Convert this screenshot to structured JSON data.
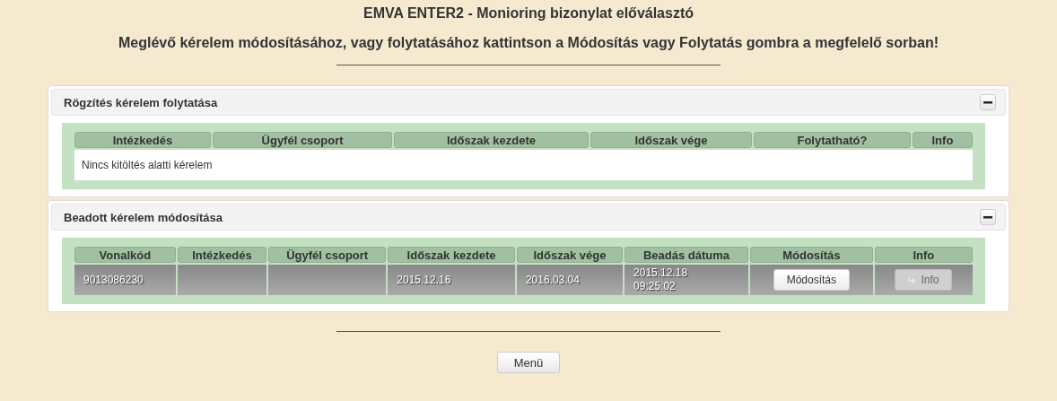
{
  "title": "EMVA ENTER2 - Monioring bizonylat előválasztó",
  "instruction": "Meglévő kérelem módosításához, vagy folytatásához kattintson a Módosítás vagy Folytatás gombra a megfelelő sorban!",
  "sections": [
    {
      "title": "Rögzítés kérelem folytatása",
      "expanded": true,
      "columns": [
        "Intézkedés",
        "Ügyfél csoport",
        "Időszak kezdete",
        "Időszak vége",
        "Folytatható?",
        "Info"
      ],
      "empty_message": "Nincs kitöltés alatti kérelem"
    },
    {
      "title": "Beadott kérelem módosítása",
      "expanded": true,
      "columns": [
        "Vonalkód",
        "Intézkedés",
        "Ügyfél csoport",
        "Időszak kezdete",
        "Időszak vége",
        "Beadás dátuma",
        "Módosítás",
        "Info"
      ],
      "rows": [
        {
          "cells": [
            {
              "kind": "text",
              "text": "9013086230"
            },
            {
              "kind": "blank"
            },
            {
              "kind": "blank"
            },
            {
              "kind": "text",
              "text": "2015.12.16"
            },
            {
              "kind": "text",
              "text": "2016.03.04"
            },
            {
              "kind": "lines",
              "lines": [
                "2015.12.18",
                "09:25:02"
              ]
            },
            {
              "kind": "button",
              "label": "Módosítás",
              "disabled": false
            },
            {
              "kind": "arrow_button",
              "label": "Info",
              "disabled": true
            }
          ]
        }
      ]
    }
  ],
  "menu_button": "Menü"
}
